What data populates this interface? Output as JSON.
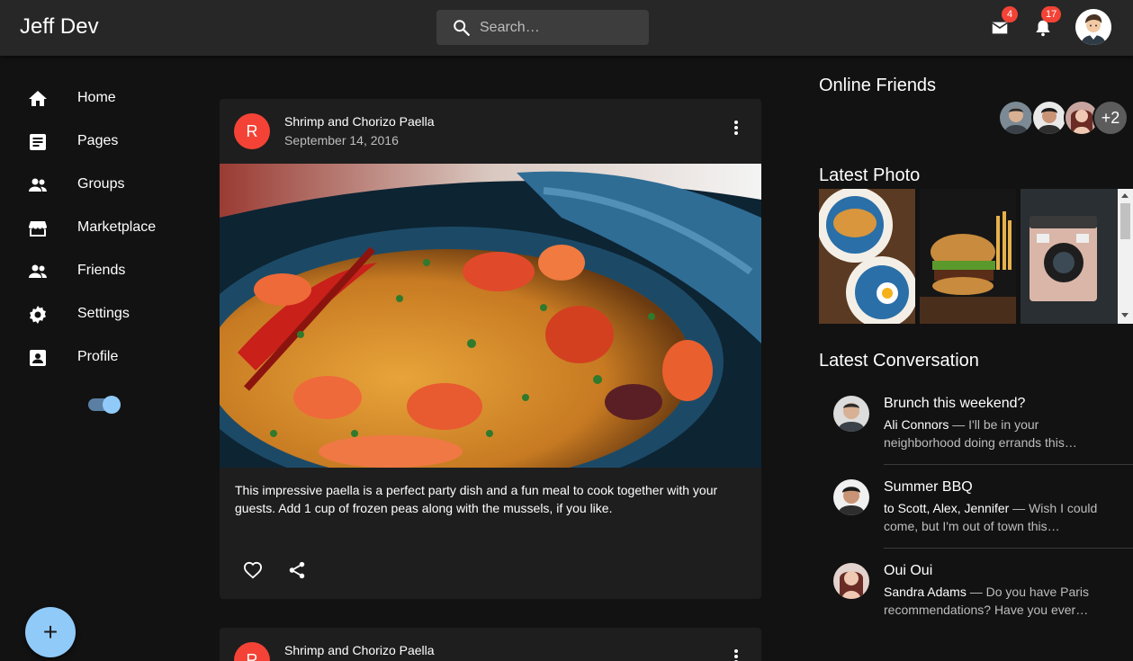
{
  "app": {
    "title": "Jeff Dev"
  },
  "search": {
    "placeholder": "Search…"
  },
  "notifications": {
    "mail_count": "4",
    "bell_count": "17"
  },
  "sidebar": {
    "items": [
      {
        "label": "Home",
        "icon": "home-icon"
      },
      {
        "label": "Pages",
        "icon": "pages-icon"
      },
      {
        "label": "Groups",
        "icon": "groups-icon"
      },
      {
        "label": "Marketplace",
        "icon": "store-icon"
      },
      {
        "label": "Friends",
        "icon": "friends-icon"
      },
      {
        "label": "Settings",
        "icon": "gear-icon"
      },
      {
        "label": "Profile",
        "icon": "profile-icon"
      }
    ],
    "dark_mode": true
  },
  "fab": {
    "label": "+"
  },
  "posts": [
    {
      "avatar_letter": "R",
      "title": "Shrimp and Chorizo Paella",
      "date": "September 14, 2016",
      "text": "This impressive paella is a perfect party dish and a fun meal to cook together with your guests. Add 1 cup of frozen peas along with the mussels, if you like."
    },
    {
      "avatar_letter": "R",
      "title": "Shrimp and Chorizo Paella"
    }
  ],
  "online_friends": {
    "title": "Online Friends",
    "more_label": "+2"
  },
  "latest_photo": {
    "title": "Latest Photo"
  },
  "latest_conversation": {
    "title": "Latest Conversation",
    "items": [
      {
        "title": "Brunch this weekend?",
        "from": "Ali Connors",
        "preview": " — I'll be in your neighborhood doing errands this…"
      },
      {
        "title": "Summer BBQ",
        "from": "to Scott, Alex, Jennifer",
        "preview": " — Wish I could come, but I'm out of town this…"
      },
      {
        "title": "Oui Oui",
        "from": "Sandra Adams",
        "preview": " — Do you have Paris recommendations? Have you ever…"
      }
    ]
  },
  "colors": {
    "accent": "#90caf9",
    "badge": "#f44336",
    "appbar": "#272727",
    "background": "#121212",
    "card": "#1e1e1e"
  }
}
